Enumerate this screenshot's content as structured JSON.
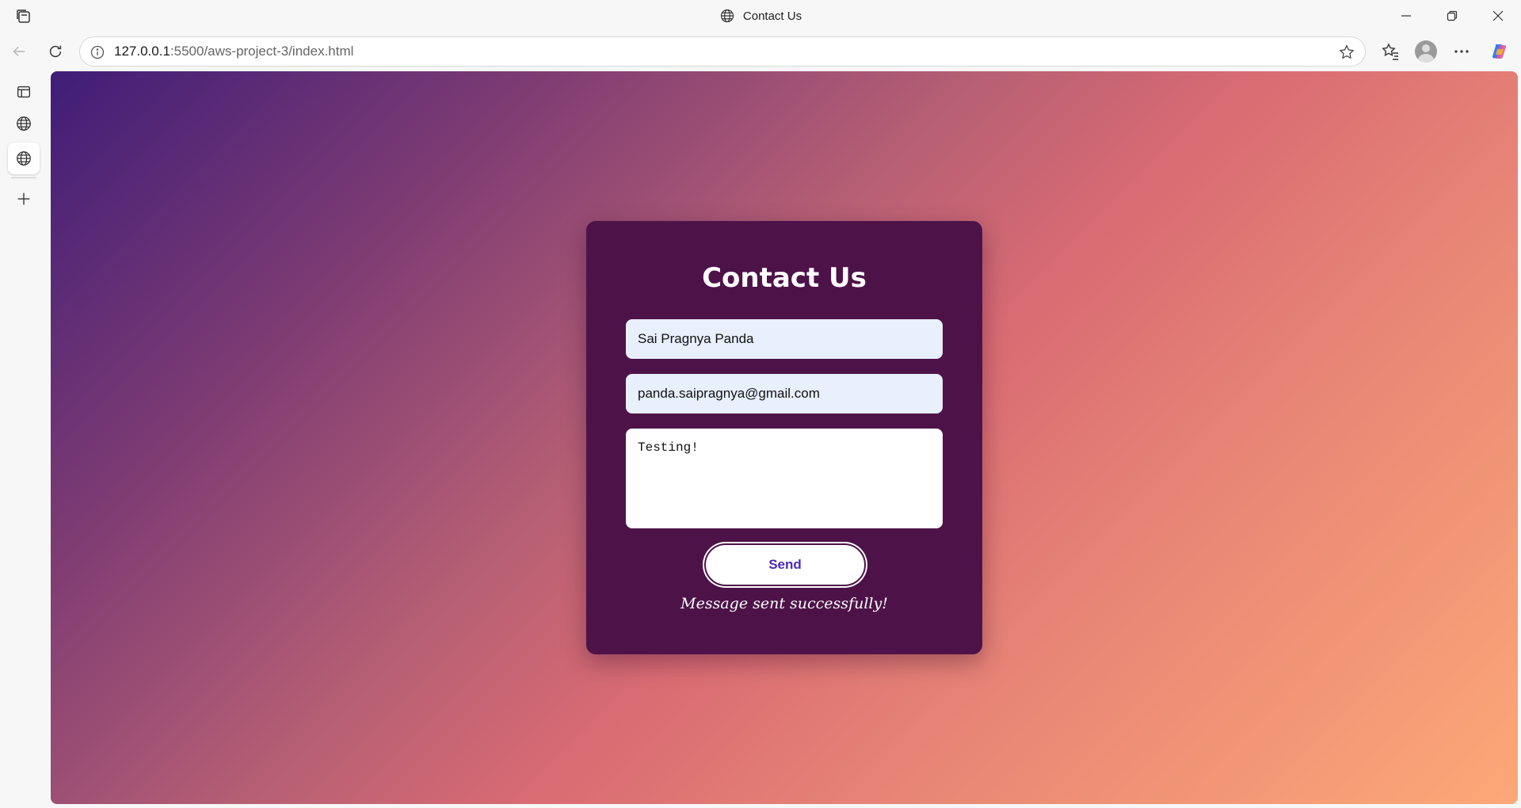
{
  "window": {
    "title": "Contact Us"
  },
  "toolbar": {
    "url_host": "127.0.0.1",
    "url_path": ":5500/aws-project-3/index.html"
  },
  "sidebar": {
    "items": [
      {
        "icon": "tab-icon"
      },
      {
        "icon": "globe-icon"
      },
      {
        "icon": "globe-icon",
        "active": true
      },
      {
        "icon": "plus-icon"
      }
    ]
  },
  "page": {
    "heading": "Contact Us",
    "form": {
      "name_value": "Sai Pragnya Panda",
      "email_value": "panda.saipragnya@gmail.com",
      "message_value": "Testing!",
      "send_label": "Send"
    },
    "status": "Message sent successfully!"
  },
  "colors": {
    "card_bg": "#4d1349",
    "gradient_start": "#3f1d78",
    "gradient_end": "#fda877",
    "button_text": "#4b2ab8",
    "input_autofill_bg": "#e8effd"
  }
}
